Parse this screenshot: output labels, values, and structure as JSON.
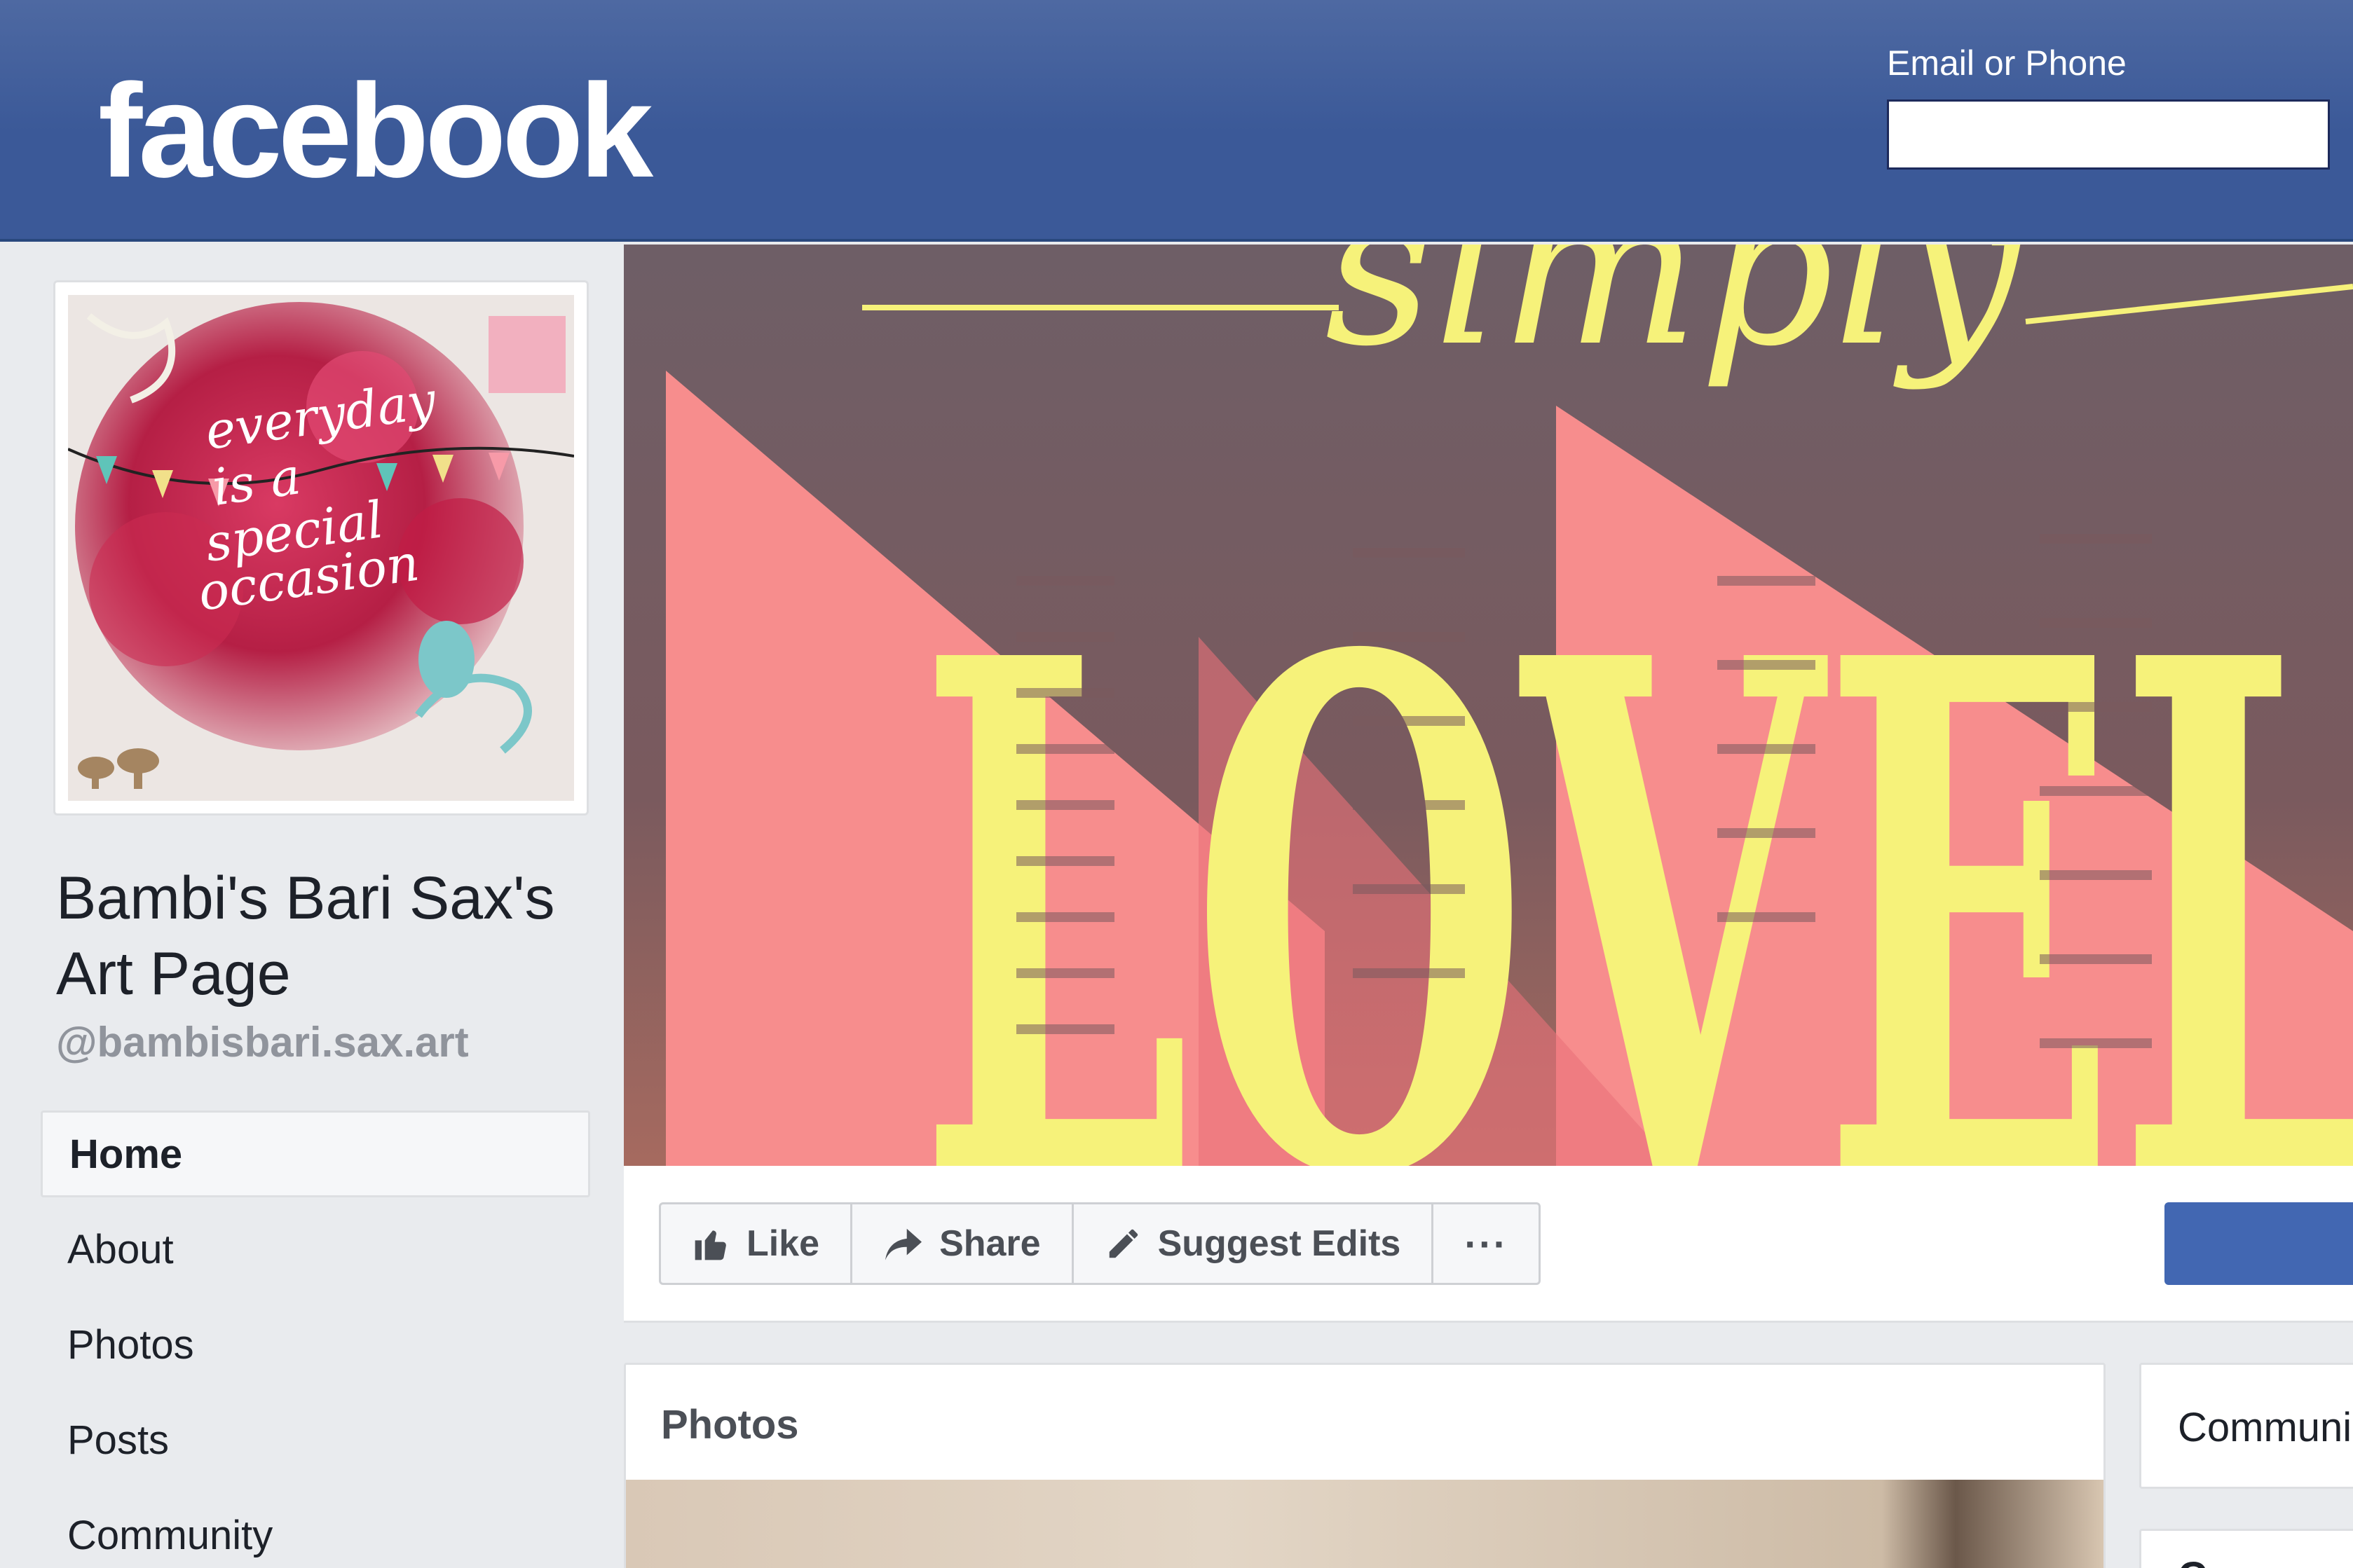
{
  "header": {
    "logo_text": "facebook",
    "login_label": "Email or Phone",
    "login_value": ""
  },
  "profile": {
    "picture_text": "everyday is a special occasion",
    "name": "Bambi's Bari Sax's Art Page",
    "handle": "@bambisbari.sax.art"
  },
  "nav": {
    "items": [
      {
        "label": "Home",
        "active": true
      },
      {
        "label": "About"
      },
      {
        "label": "Photos"
      },
      {
        "label": "Posts"
      },
      {
        "label": "Community"
      }
    ]
  },
  "cover": {
    "script_text": "simply",
    "block_text": "LOVEL"
  },
  "actions": {
    "like_label": "Like",
    "share_label": "Share",
    "suggest_label": "Suggest Edits",
    "more_label": "···"
  },
  "photos_card": {
    "title": "Photos"
  },
  "community_card": {
    "title": "Communi",
    "title2": "Community"
  },
  "colors": {
    "brand_blue": "#3b5998",
    "primary_button": "#4267b2",
    "cover_yellow": "#f6f27a",
    "cover_pink": "#f78d8d"
  }
}
